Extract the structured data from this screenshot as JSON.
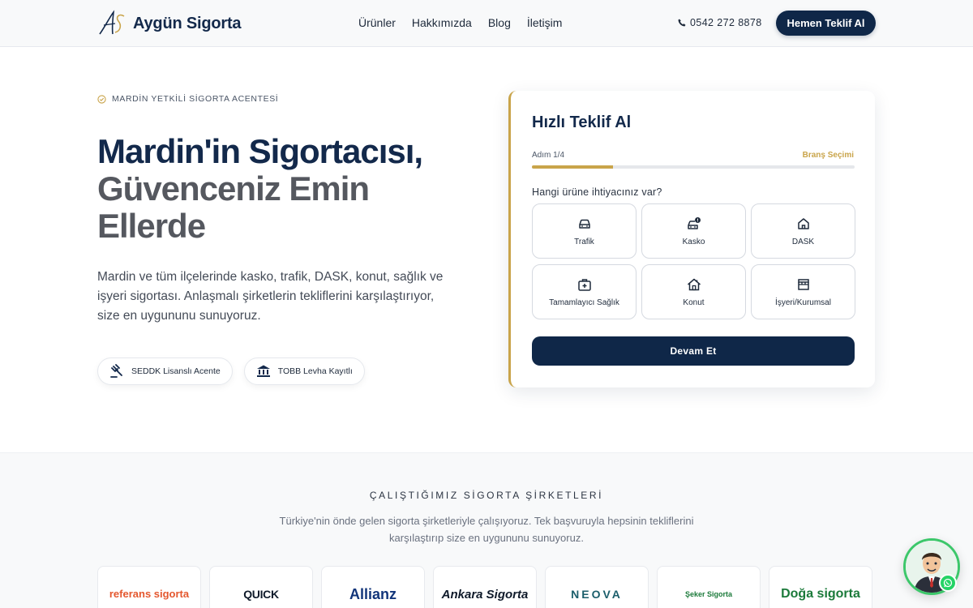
{
  "header": {
    "brand": "Aygün Sigorta",
    "nav": [
      "Ürünler",
      "Hakkımızda",
      "Blog",
      "İletişim"
    ],
    "phone": "0542 272 8878",
    "cta": "Hemen Teklif Al"
  },
  "hero": {
    "eyebrow": "MARDİN YETKİLİ SİGORTA ACENTESİ",
    "title_line1": "Mardin'in Sigortacısı,",
    "title_line2": "Güvenceniz Emin Ellerde",
    "description": "Mardin ve tüm ilçelerinde kasko, trafik, DASK, konut, sağlık ve işyeri sigortası. Anlaşmalı şirketlerin tekliflerini karşılaştırıyor, size en uygununu sunuyoruz.",
    "badges": [
      "SEDDK Lisanslı Acente",
      "TOBB Levha Kayıtlı"
    ]
  },
  "quote": {
    "title": "Hızlı Teklif Al",
    "step": "Adım 1/4",
    "step_name": "Branş Seçimi",
    "progress": 0.25,
    "question": "Hangi ürüne ihtiyacınız var?",
    "options": [
      "Trafik",
      "Kasko",
      "DASK",
      "Tamamlayıcı Sağlık",
      "Konut",
      "İşyeri/Kurumsal"
    ],
    "continue": "Devam Et"
  },
  "partners": {
    "title": "ÇALIŞTIĞIMIZ SİGORTA ŞİRKETLERİ",
    "description": "Türkiye'nin önde gelen sigorta şirketleriyle çalışıyoruz. Tek başvuruyla hepsinin tekliflerini karşılaştırıp size en uygununu sunuyoruz.",
    "logos": [
      "referans sigorta",
      "QUICK",
      "Allianz",
      "Ankara Sigorta",
      "NEOVA",
      "Şeker Sigorta",
      "Doğa sigorta"
    ]
  },
  "colors": {
    "navy": "#0f2748",
    "gold": "#c9a44a",
    "whatsapp": "#25d366"
  }
}
